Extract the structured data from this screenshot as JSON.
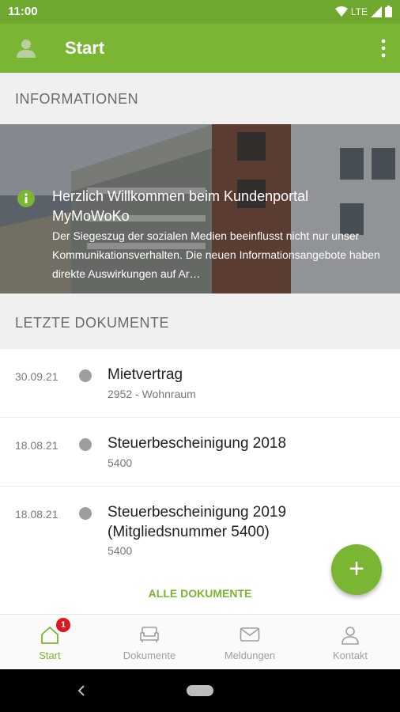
{
  "status_bar": {
    "time": "11:00",
    "network": "LTE"
  },
  "app_bar": {
    "title": "Start"
  },
  "info_section": {
    "header": "INFORMATIONEN",
    "banner_title": "Herzlich Willkommen beim Kundenportal MyMoWoKo",
    "banner_text": "Der Siegeszug der sozialen Medien beeinflusst nicht nur unser Kommunikationsverhalten. Die neuen Informationsangebote haben direkte Auswirkungen auf Ar…"
  },
  "documents_section": {
    "header": "LETZTE DOKUMENTE",
    "items": [
      {
        "date": "30.09.21",
        "title": "Mietvertrag",
        "subtitle": "2952 - Wohnraum"
      },
      {
        "date": "18.08.21",
        "title": "Steuerbescheinigung 2018",
        "subtitle": "5400"
      },
      {
        "date": "18.08.21",
        "title": "Steuerbescheinigung 2019 (Mitgliedsnummer 5400)",
        "subtitle": "5400"
      }
    ],
    "all_link": "ALLE DOKUMENTE"
  },
  "fab": {
    "label": "+"
  },
  "bottom_nav": {
    "items": [
      {
        "label": "Start",
        "badge": "1"
      },
      {
        "label": "Dokumente"
      },
      {
        "label": "Meldungen"
      },
      {
        "label": "Kontakt"
      }
    ]
  },
  "colors": {
    "primary": "#7ab534",
    "status_bar": "#6ea82f",
    "badge": "#e0161f"
  }
}
